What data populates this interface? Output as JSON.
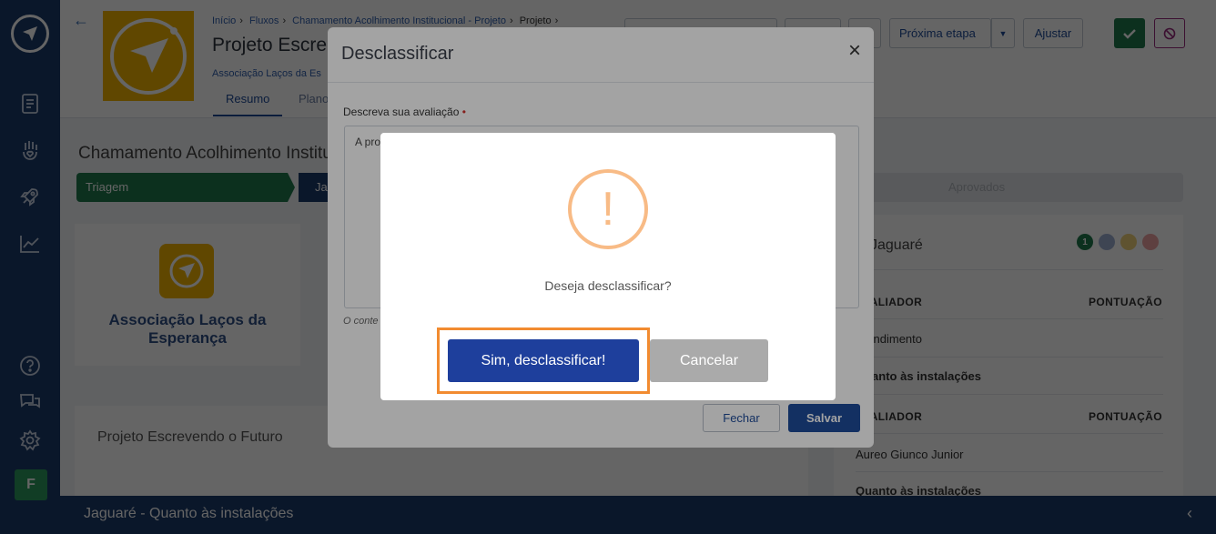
{
  "sidebar": {
    "avatar_letter": "F"
  },
  "header": {
    "breadcrumb": [
      "Início",
      "Fluxos",
      "Chamamento Acolhimento Institucional - Projeto",
      "Projeto"
    ],
    "title": "Projeto Escre",
    "org": "Associação Laços da Es",
    "tabs": [
      "Resumo",
      "Plano"
    ],
    "next_step_label": "Próxima etapa",
    "adjust_label": "Ajustar"
  },
  "main": {
    "title": "Chamamento Acolhimento Instituc",
    "steps": [
      {
        "label": "Triagem"
      },
      {
        "label": "Ja"
      },
      {
        "label": "Aprovados"
      }
    ],
    "org_card_name": "Associação Laços da Esperança",
    "project_title": "Projeto Escrevendo o Futuro",
    "right_panel": {
      "name": "Jaguaré",
      "status_count": "1",
      "col_avaliador": "AVALIADOR",
      "col_pontuacao": "PONTUAÇÃO",
      "rows": [
        "Atendimento",
        "Quanto às instalações",
        "Aureo Giunco Junior",
        "Quanto às instalações"
      ]
    },
    "bottom_bar_title": "Jaguaré - Quanto às instalações"
  },
  "modal": {
    "title": "Desclassificar",
    "label": "Descreva sua avaliação",
    "required_mark": "•",
    "textarea_value": "A pro",
    "help_text": "O conte",
    "close_label": "Fechar",
    "save_label": "Salvar"
  },
  "confirm": {
    "icon_glyph": "!",
    "text": "Deseja desclassificar?",
    "yes_label": "Sim, desclassificar!",
    "no_label": "Cancelar"
  },
  "colors": {
    "sidebar": "#1b3a6b",
    "primary": "#1e4b9a",
    "success": "#1f7a4d",
    "brand_yellow": "#f2b400",
    "warning_icon": "#f8bb86",
    "highlight": "#f28b30"
  }
}
